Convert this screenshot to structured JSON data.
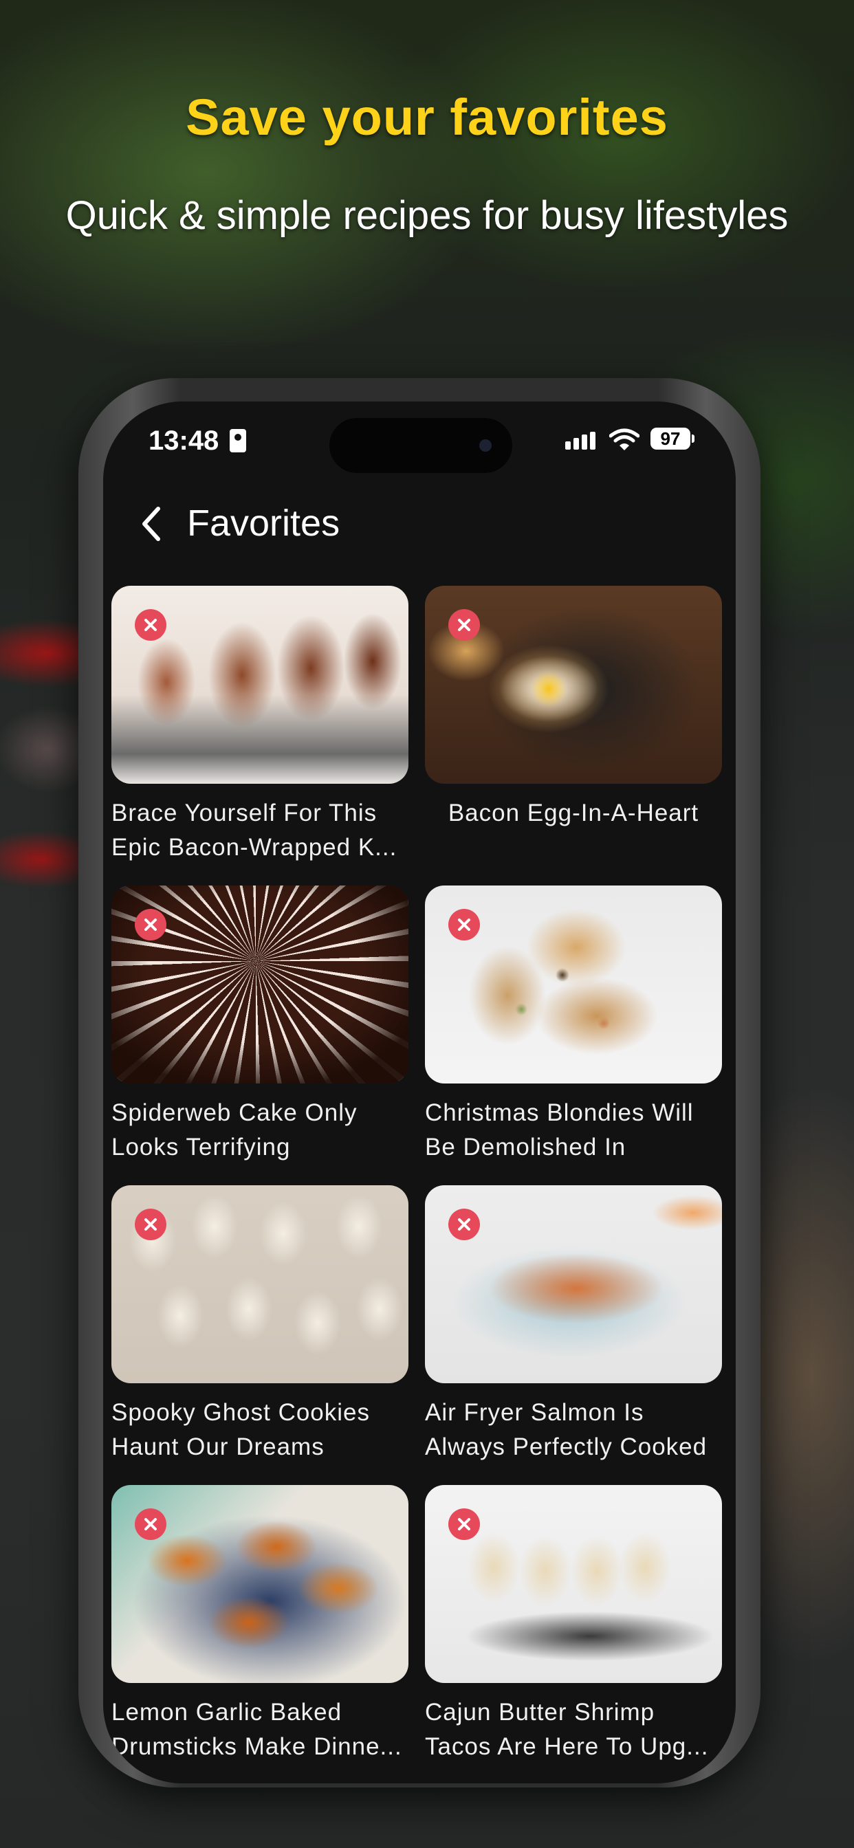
{
  "headline": "Save your favorites",
  "subheadline": "Quick & simple recipes for busy lifestyles",
  "status_bar": {
    "time": "13:48",
    "battery": "97"
  },
  "nav": {
    "title": "Favorites"
  },
  "favorites": [
    {
      "title": "Brace Yourself For This Epic Bacon-Wrapped K..."
    },
    {
      "title": "Bacon Egg-In-A-Heart"
    },
    {
      "title": "Spiderweb Cake Only Looks Terrifying"
    },
    {
      "title": "Christmas Blondies Will Be Demolished In SECO..."
    },
    {
      "title": "Spooky Ghost Cookies Haunt Our Dreams"
    },
    {
      "title": "Air Fryer Salmon Is Always Perfectly Cooked"
    },
    {
      "title": "Lemon Garlic Baked Drumsticks Make Dinne..."
    },
    {
      "title": "Cajun Butter Shrimp Tacos Are Here To Upg..."
    }
  ],
  "colors": {
    "accent_yellow": "#ffd21a",
    "remove_badge": "#e64a5a",
    "screen_bg": "#121212"
  }
}
